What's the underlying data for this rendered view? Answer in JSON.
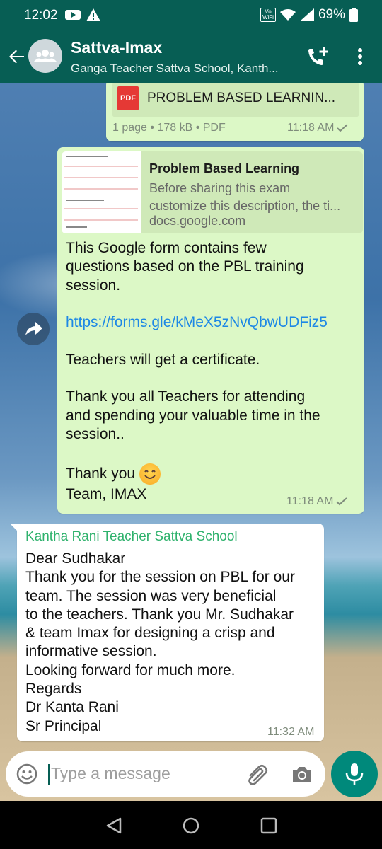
{
  "status": {
    "time": "12:02",
    "volte": "Vo\nWiFi",
    "battery": "69%"
  },
  "header": {
    "title": "Sattva-Imax",
    "subtitle": "Ganga Teacher Sattva School, Kanth..."
  },
  "messages": {
    "doc": {
      "file_name": "PROBLEM BASED LEARNIN...",
      "meta": "1 page • 178 kB • PDF",
      "time": "11:18 AM",
      "pdf_label": "PDF"
    },
    "link": {
      "preview_title": "Problem Based Learning",
      "preview_desc_1": "Before sharing this exam",
      "preview_desc_2": "customize this description, the ti...",
      "preview_site": "docs.google.com",
      "lines": [
        "This Google form contains few",
        "questions based on the PBL training",
        "session.",
        "",
        "https://forms.gle/kMeX5zNvQbwUDFiz5",
        "",
        "Teachers will get a  certificate.",
        "",
        "Thank you all Teachers for attending",
        "and spending your valuable time in the",
        "session..",
        "",
        "Thank you",
        "Team, IMAX"
      ],
      "time": "11:18 AM"
    },
    "incoming": {
      "sender": "Kantha Rani Teacher Sattva School",
      "lines": [
        "Dear Sudhakar",
        "Thank you for the session on PBL for our",
        "team. The session was very beneficial",
        "to  the teachers. Thank you Mr. Sudhakar",
        "& team Imax for designing a crisp and",
        "informative session.",
        "Looking forward for much more.",
        "Regards",
        "Dr Kanta Rani",
        "Sr Principal"
      ],
      "time": "11:32 AM"
    }
  },
  "composer": {
    "placeholder": "Type a message"
  },
  "colors": {
    "header": "#075e54",
    "outgoing": "#dcf8c6",
    "accent": "#00897b",
    "sender": "#2fb26d",
    "link": "#1e88e5"
  },
  "icons": [
    "back-arrow-icon",
    "group-avatar-icon",
    "add-call-icon",
    "more-vert-icon",
    "forward-icon",
    "emoji-icon",
    "attach-icon",
    "camera-icon",
    "mic-icon"
  ]
}
